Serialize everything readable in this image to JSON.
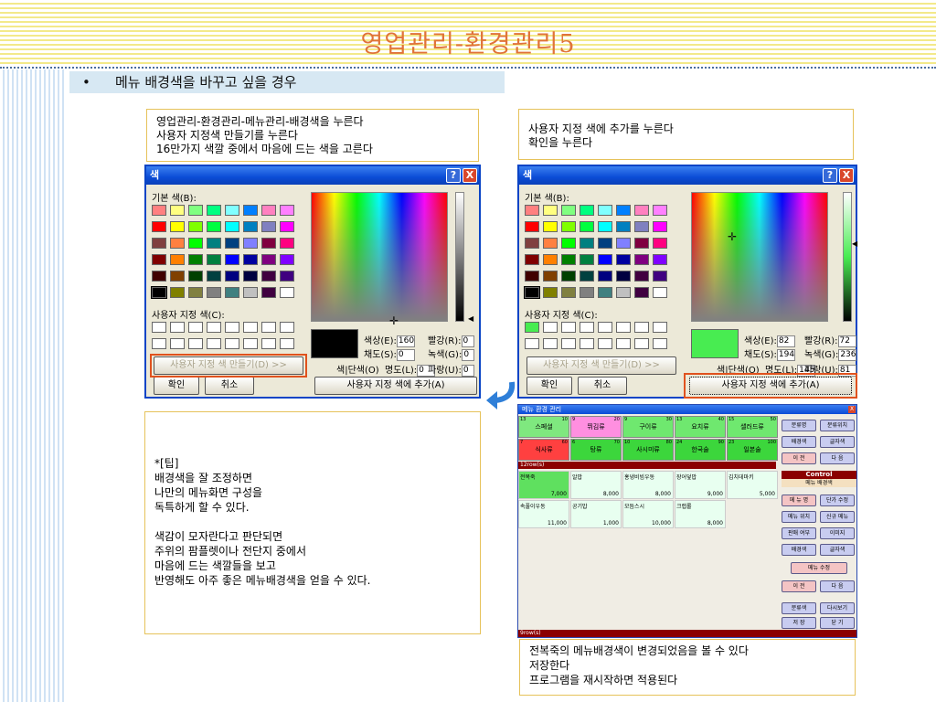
{
  "slide": {
    "title": "영업관리-환경관리5",
    "bullet": "•",
    "bullet_text": "메뉴 배경색을 바꾸고 싶을 경우"
  },
  "notes": {
    "left_top": [
      "영업관리-환경관리-메뉴관리-배경색을 누른다",
      "사용자 지정색 만들기를 누른다",
      "16만가지 색깔 중에서 마음에 드는 색을 고른다"
    ],
    "right_top": [
      "사용자 지정 색에 추가를 누른다",
      "확인을 누른다"
    ],
    "tip": [
      "*[팁]",
      "배경색을 잘 조정하면",
      "나만의 메뉴화면 구성을",
      "독특하게 할 수 있다.",
      "",
      "색감이 모자란다고 판단되면",
      "주위의 팜플렛이나 전단지 중에서",
      "마음에 드는 색깔들을 보고",
      "반영해도 아주 좋은 메뉴배경색을 얻을 수 있다."
    ],
    "bottom_right": [
      "전복죽의 메뉴배경색이 변경되었음을 볼 수 있다",
      "저장한다",
      "프로그램을 재시작하면 적용된다"
    ]
  },
  "color_dialog": {
    "title": "색",
    "help": "?",
    "close": "X",
    "basic_colors_label": "기본 색(B):",
    "custom_colors_label": "사용자 지정 색(C):",
    "define_custom": "사용자 지정 색 만들기(D) >>",
    "solid_label": "색|단색(O)",
    "ok": "확인",
    "cancel": "취소",
    "add_custom": "사용자 지정 색에 추가(A)",
    "hue_label": "색상(E):",
    "sat_label": "채도(S):",
    "lum_label": "명도(L):",
    "red_label": "빨강(R):",
    "green_label": "녹색(G):",
    "blue_label": "파랑(U):",
    "basic_colors": [
      "#ff8080",
      "#ffff80",
      "#80ff80",
      "#00ff80",
      "#80ffff",
      "#0080ff",
      "#ff80c0",
      "#ff80ff",
      "#ff0000",
      "#ffff00",
      "#80ff00",
      "#00ff40",
      "#00ffff",
      "#0080c0",
      "#8080c0",
      "#ff00ff",
      "#804040",
      "#ff8040",
      "#00ff00",
      "#008080",
      "#004080",
      "#8080ff",
      "#800040",
      "#ff0080",
      "#800000",
      "#ff8000",
      "#008000",
      "#008040",
      "#0000ff",
      "#0000a0",
      "#800080",
      "#8000ff",
      "#400000",
      "#804000",
      "#004000",
      "#004040",
      "#000080",
      "#000040",
      "#400040",
      "#400080",
      "#000000",
      "#808000",
      "#808040",
      "#808080",
      "#408080",
      "#c0c0c0",
      "#400040",
      "#ffffff"
    ],
    "left": {
      "hue": "160",
      "sat": "0",
      "lum": "0",
      "red": "0",
      "green": "0",
      "blue": "0",
      "preview": "#000000"
    },
    "right": {
      "hue": "82",
      "sat": "194",
      "lum": "145",
      "red": "72",
      "green": "236",
      "blue": "81",
      "preview": "#48ec51",
      "custom_first": "#48ec51"
    }
  },
  "menu_window": {
    "title": "메뉴 환경 관리",
    "close": "X",
    "groups": [
      {
        "n": "13",
        "n2": "10",
        "name": "스페셜",
        "color": "#7fe87f"
      },
      {
        "n": "9",
        "n2": "20",
        "name": "뛰김류",
        "color": "#ff8fe0"
      },
      {
        "n": "9",
        "n2": "30",
        "name": "구이류",
        "color": "#6fe86f"
      },
      {
        "n": "13",
        "n2": "40",
        "name": "요치류",
        "color": "#6fe86f"
      },
      {
        "n": "15",
        "n2": "50",
        "name": "샐러드류",
        "color": "#6fe86f"
      },
      {
        "n": "7",
        "n2": "60",
        "name": "식사류",
        "color": "#ff4040"
      },
      {
        "n": "6",
        "n2": "70",
        "name": "탕류",
        "color": "#3cd63c"
      },
      {
        "n": "10",
        "n2": "80",
        "name": "사시미류",
        "color": "#3cd63c"
      },
      {
        "n": "24",
        "n2": "90",
        "name": "한국술",
        "color": "#3cd63c"
      },
      {
        "n": "23",
        "n2": "100",
        "name": "일본술",
        "color": "#3cd63c"
      }
    ],
    "group_bar": "12row(s)",
    "items": [
      {
        "name": "전복죽",
        "price": "7,000",
        "color": "#5fe05f"
      },
      {
        "name": "알밥",
        "price": "8,000",
        "color": "#e8fff0"
      },
      {
        "name": "홍냉비빔우동",
        "price": "8,000",
        "color": "#e8fff0"
      },
      {
        "name": "장어덮밥",
        "price": "9,000",
        "color": "#e8fff0"
      },
      {
        "name": "김치데마키",
        "price": "5,000",
        "color": "#e8fff0"
      },
      {
        "name": "속풀이우동",
        "price": "11,000",
        "color": "#e8fff0"
      },
      {
        "name": "공기밥",
        "price": "1,000",
        "color": "#e8fff0"
      },
      {
        "name": "모듬스시",
        "price": "10,000",
        "color": "#e8fff0"
      },
      {
        "name": "크랩롤",
        "price": "8,000",
        "color": "#e8fff0"
      }
    ],
    "item_bar": "9row(s)",
    "control_title": "Control",
    "control_sub": "메뉴 배경색",
    "side_buttons": [
      [
        "분류명",
        "분류위치"
      ],
      [
        "배경색",
        "글자색"
      ],
      [
        "이 전",
        "다 음"
      ]
    ],
    "ctl_buttons": [
      [
        "메 뉴 명",
        "단가 수정"
      ],
      [
        "메뉴 위치",
        "신규 메뉴"
      ],
      [
        "판매 여부",
        "이미지"
      ],
      [
        "배경색",
        "글자색"
      ]
    ],
    "menu_edit": "메뉴 수정",
    "nav": [
      "이 전",
      "다 음"
    ],
    "bottom_buttons": [
      [
        "분류색",
        "다시보기"
      ],
      [
        "저 장",
        "닫 기"
      ]
    ]
  }
}
